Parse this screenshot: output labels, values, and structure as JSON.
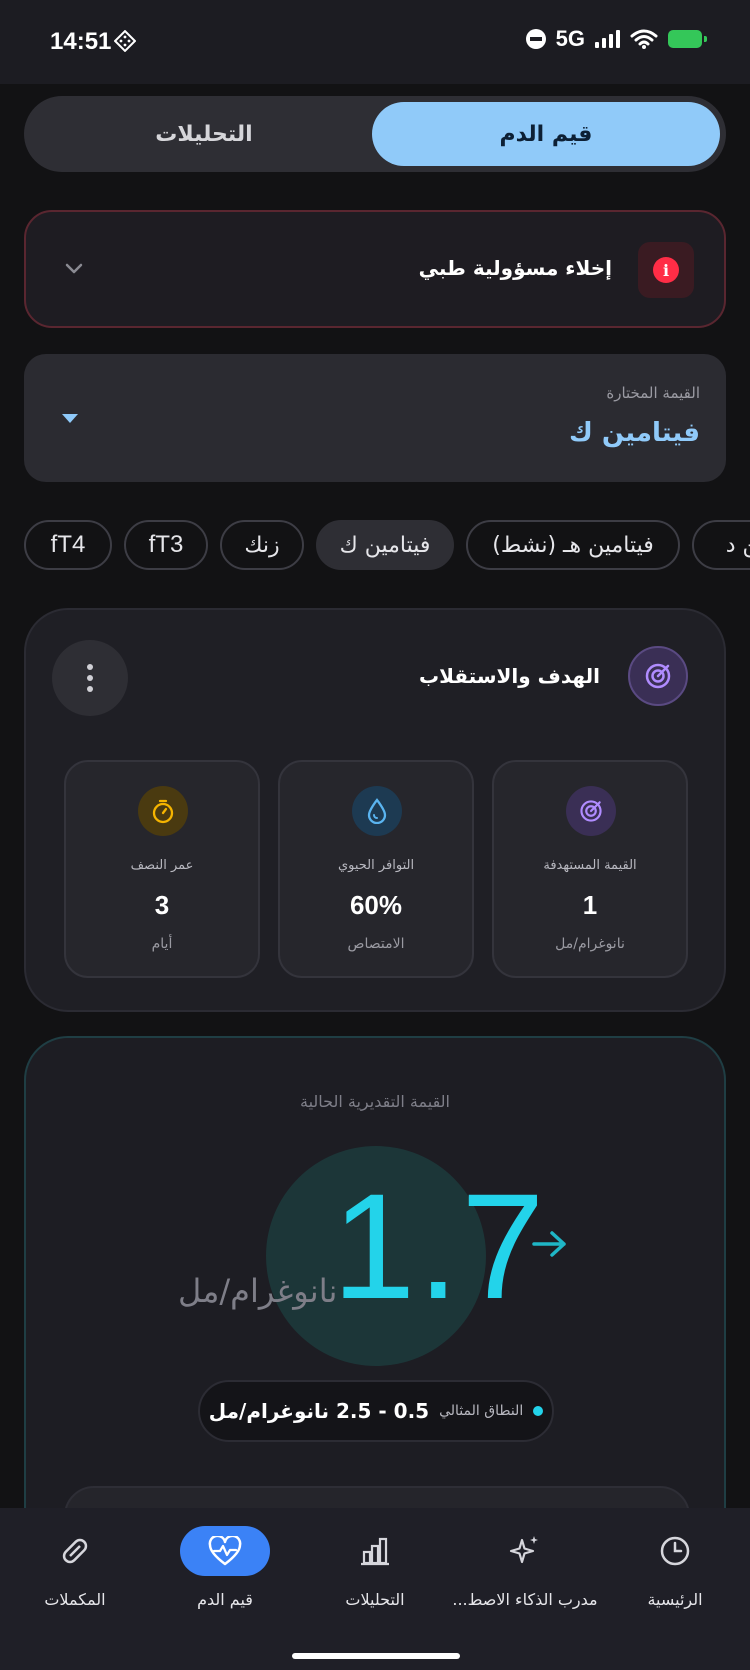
{
  "status_bar": {
    "time": "14:51",
    "network": "5G"
  },
  "tabs": {
    "active": "قيم الدم",
    "inactive": "التحليلات"
  },
  "disclaimer": {
    "title": "إخلاء مسؤولية طبي",
    "icon": "info-icon"
  },
  "selector": {
    "label": "القيمة المختارة",
    "value": "فيتامين ك"
  },
  "chips": [
    "fT4",
    "fT3",
    "زنك",
    "فيتامين ك",
    "فيتامين هـ (نشط)",
    "فيتامين د"
  ],
  "chips_active": "فيتامين ك",
  "goal": {
    "title": "الهدف والاستقلاب",
    "stats": [
      {
        "label": "القيمة المستهدفة",
        "value": "1",
        "unit": "نانوغرام/مل",
        "icon": "target-icon",
        "color": "#b08cff"
      },
      {
        "label": "التوافر الحيوي",
        "value": "60%",
        "unit": "الامتصاص",
        "icon": "water-drop-icon",
        "color": "#5ab4f0"
      },
      {
        "label": "عمر النصف",
        "value": "3",
        "unit": "أيام",
        "icon": "timer-icon",
        "color": "#f5b400"
      }
    ]
  },
  "current": {
    "label": "القيمة التقديرية الحالية",
    "value": "1.7",
    "unit": "نانوغرام/مل",
    "range_label": "النطاق المثالي",
    "range_value": "0.5 - 2.5 نانوغرام/مل"
  },
  "nav": [
    {
      "label": "الرئيسية",
      "icon": "clock-icon"
    },
    {
      "label": "مدرب الذكاء الاصط...",
      "icon": "sparkle-icon"
    },
    {
      "label": "التحليلات",
      "icon": "bar-chart-icon"
    },
    {
      "label": "قيم الدم",
      "icon": "heart-pulse-icon",
      "active": true
    },
    {
      "label": "المكملات",
      "icon": "pill-icon"
    }
  ],
  "colors": {
    "accent": "#90caf9",
    "value": "#23d3ea",
    "nav_active": "#3b82f6",
    "alert": "#ff2d46"
  }
}
